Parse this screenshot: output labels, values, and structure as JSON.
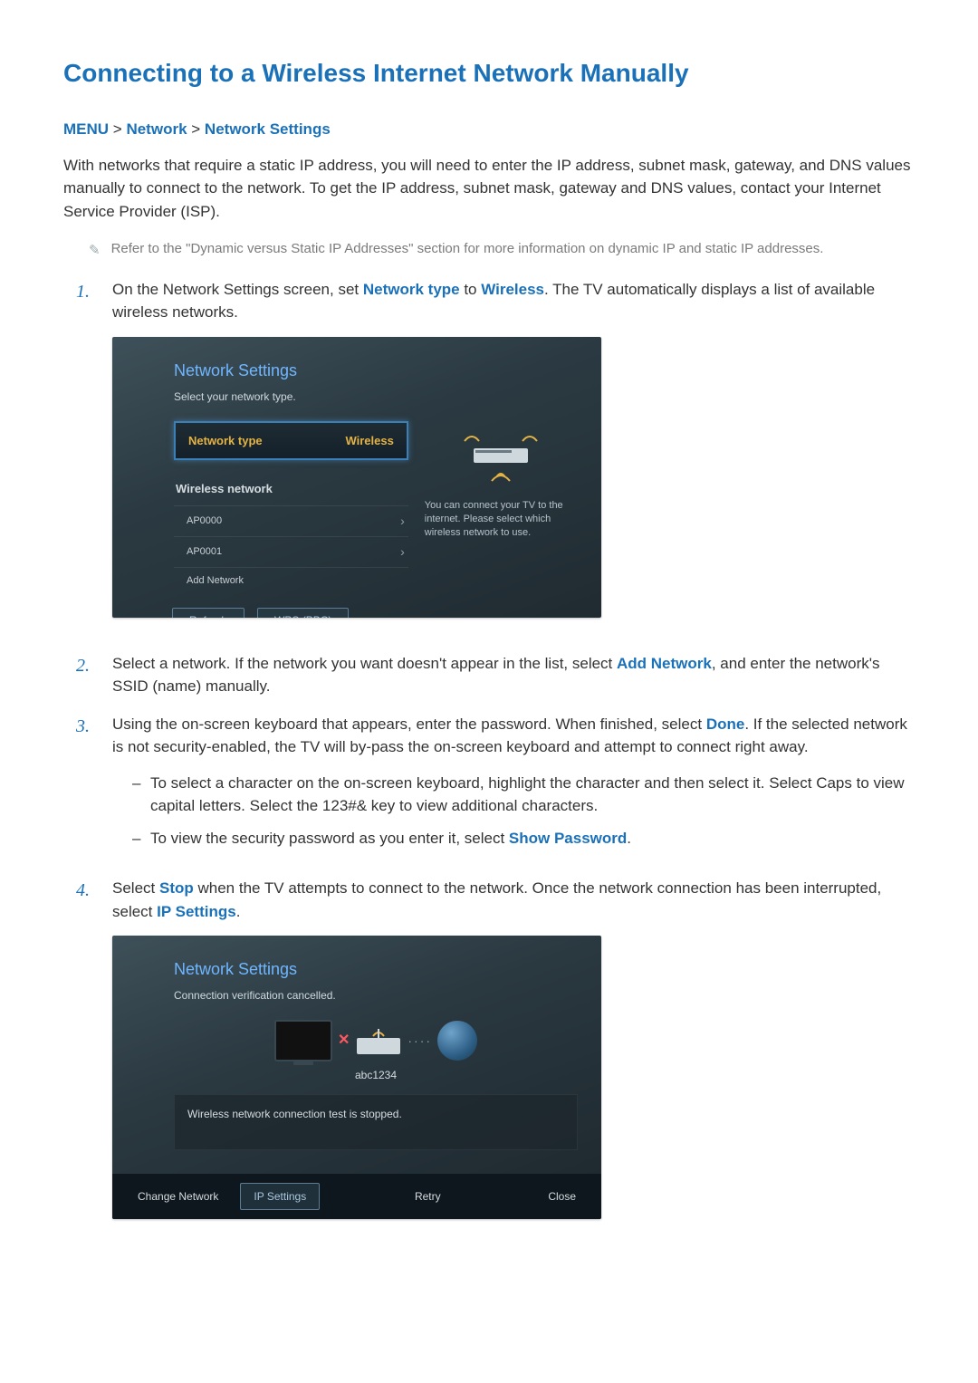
{
  "title": "Connecting to a Wireless Internet Network Manually",
  "breadcrumb": {
    "menu": "MENU",
    "network": "Network",
    "settings": "Network Settings"
  },
  "intro": "With networks that require a static IP address, you will need to enter the IP address, subnet mask, gateway, and DNS values manually to connect to the network. To get the IP address, subnet mask, gateway and DNS values, contact your Internet Service Provider (ISP).",
  "note": "Refer to the \"Dynamic versus Static IP Addresses\" section for more information on dynamic IP and static IP addresses.",
  "steps": {
    "s1": {
      "pre": "On the Network Settings screen, set ",
      "kw1": "Network type",
      "mid": " to ",
      "kw2": "Wireless",
      "post": ". The TV automatically displays a list of available wireless networks."
    },
    "s2": {
      "pre": "Select a network. If the network you want doesn't appear in the list, select ",
      "kw1": "Add Network",
      "post": ", and enter the network's SSID (name) manually."
    },
    "s3": {
      "pre": "Using the on-screen keyboard that appears, enter the password. When finished, select ",
      "kw1": "Done",
      "post": ". If the selected network is not security-enabled, the TV will by-pass the on-screen keyboard and attempt to connect right away."
    },
    "s3a": "To select a character on the on-screen keyboard, highlight the character and then select it. Select Caps to view capital letters. Select the 123#& key to view additional characters.",
    "s3b": {
      "pre": "To view the security password as you enter it, select ",
      "kw1": "Show Password",
      "post": "."
    },
    "s4": {
      "pre": "Select ",
      "kw1": "Stop",
      "mid": " when the TV attempts to connect to the network. Once the network connection has been interrupted, select ",
      "kw2": "IP Settings",
      "post": "."
    }
  },
  "panel1": {
    "title": "Network Settings",
    "subtitle": "Select your network type.",
    "network_type_label": "Network type",
    "network_type_value": "Wireless",
    "list_header": "Wireless network",
    "networks": [
      "AP0000",
      "AP0001"
    ],
    "add_network": "Add Network",
    "help": "You can connect your TV to the internet. Please select which wireless network to use.",
    "buttons": {
      "refresh": "Refresh",
      "wps": "WPS (PBC)"
    }
  },
  "panel2": {
    "title": "Network Settings",
    "subtitle": "Connection verification cancelled.",
    "ssid": "abc1234",
    "status": "Wireless network connection test is stopped.",
    "buttons": {
      "change": "Change Network",
      "ip": "IP Settings",
      "retry": "Retry",
      "close": "Close"
    }
  }
}
